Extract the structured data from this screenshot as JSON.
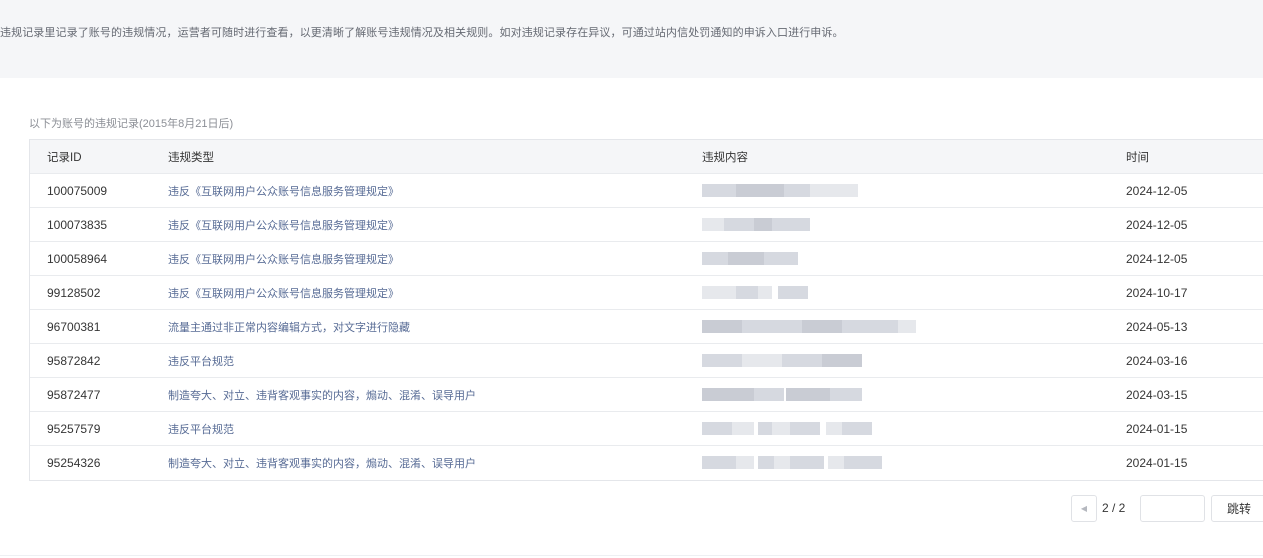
{
  "notice": {
    "text": "违规记录里记录了账号的违规情况，运营者可随时进行查看，以更清晰了解账号违规情况及相关规则。如对违规记录存在异议，可通过站内信处罚通知的申诉入口进行申诉。"
  },
  "section": {
    "caption": "以下为账号的违规记录(2015年8月21日后)"
  },
  "table": {
    "columns": [
      "记录ID",
      "违规类型",
      "违规内容",
      "时间"
    ],
    "rows": [
      {
        "id": "100075009",
        "type": "违反《互联网用户公众账号信息服务管理规定》",
        "time": "2024-12-05"
      },
      {
        "id": "100073835",
        "type": "违反《互联网用户公众账号信息服务管理规定》",
        "time": "2024-12-05"
      },
      {
        "id": "100058964",
        "type": "违反《互联网用户公众账号信息服务管理规定》",
        "time": "2024-12-05"
      },
      {
        "id": "99128502",
        "type": "违反《互联网用户公众账号信息服务管理规定》",
        "time": "2024-10-17"
      },
      {
        "id": "96700381",
        "type": "流量主通过非正常内容编辑方式，对文字进行隐藏",
        "time": "2024-05-13"
      },
      {
        "id": "95872842",
        "type": "违反平台规范",
        "time": "2024-03-16"
      },
      {
        "id": "95872477",
        "type": "制造夸大、对立、违背客观事实的内容，煽动、混淆、误导用户",
        "time": "2024-03-15"
      },
      {
        "id": "95257579",
        "type": "违反平台规范",
        "time": "2024-01-15"
      },
      {
        "id": "95254326",
        "type": "制造夸大、对立、违背客观事实的内容，煽动、混淆、误导用户",
        "time": "2024-01-15"
      }
    ]
  },
  "pager": {
    "prev_icon": "triangle-left-icon",
    "count": "2 / 2",
    "input_value": "",
    "go_label": "跳转"
  }
}
